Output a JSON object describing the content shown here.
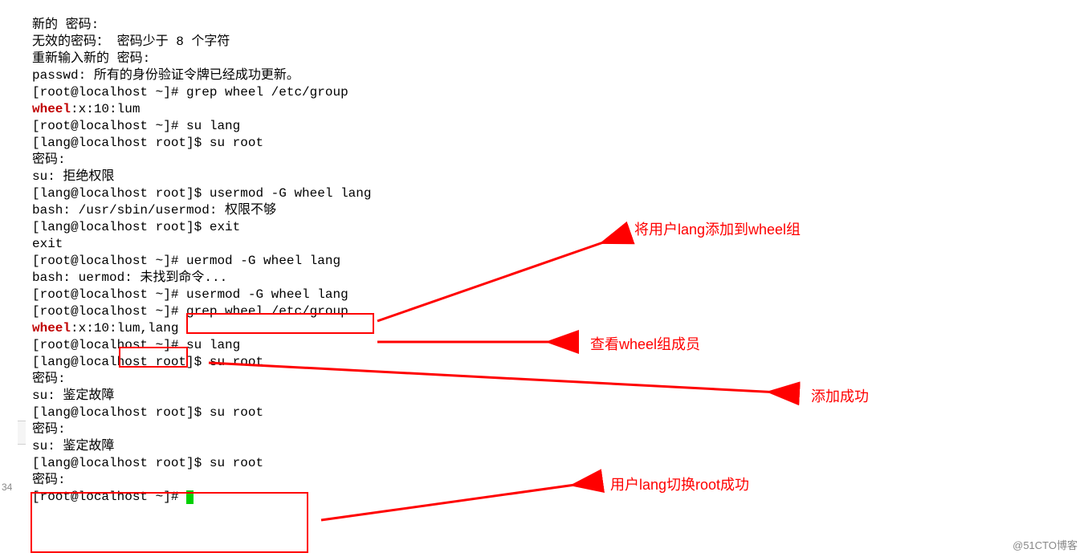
{
  "gutter": {
    "num": "34"
  },
  "terminal": {
    "l1": "新的 密码:",
    "l2": "无效的密码： 密码少于 8 个字符",
    "l3": "重新输入新的 密码:",
    "l4": "passwd: 所有的身份验证令牌已经成功更新。",
    "l5a": "[root@localhost ~]# grep wheel /etc/group",
    "l6_a": "wheel",
    "l6_b": ":x:10:lum",
    "l7": "[root@localhost ~]# su lang",
    "l8": "[lang@localhost root]$ su root",
    "l9": "密码:",
    "l10": "su: 拒绝权限",
    "l11": "[lang@localhost root]$ usermod -G wheel lang",
    "l12": "bash: /usr/sbin/usermod: 权限不够",
    "l13": "[lang@localhost root]$ exit",
    "l14": "exit",
    "l15": "[root@localhost ~]# uermod -G wheel lang",
    "l16": "bash: uermod: 未找到命令...",
    "l17a": "[root@localhost ~]# ",
    "l17b": "usermod -G wheel lang",
    "l18": "[root@localhost ~]# grep wheel /etc/group",
    "l19_a": "wheel",
    "l19_b": ":x:10:",
    "l19_c": "lum,lang",
    "l20": "[root@localhost ~]# su lang",
    "l21": "[lang@localhost root]$ su root",
    "l22": "密码:",
    "l23": "su: 鉴定故障",
    "l24": "[lang@localhost root]$ su root",
    "l25": "密码:",
    "l26": "su: 鉴定故障",
    "l27": "[lang@localhost root]$ su root",
    "l28": "密码:",
    "l29": "[root@localhost ~]# "
  },
  "annotations": {
    "a1": "将用户lang添加到wheel组",
    "a2": "查看wheel组成员",
    "a3": "添加成功",
    "a4": "用户lang切换root成功"
  },
  "watermark": "@51CTO博客"
}
